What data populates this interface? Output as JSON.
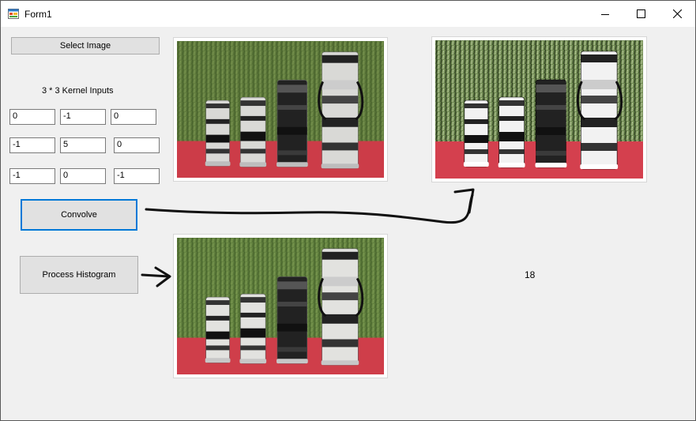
{
  "window": {
    "title": "Form1"
  },
  "buttons": {
    "select_image": "Select Image",
    "convolve": "Convolve",
    "process_histogram": "Process Histogram"
  },
  "kernel": {
    "label": "3 * 3 Kernel Inputs",
    "rows": [
      [
        "0",
        "-1",
        "0"
      ],
      [
        "-1",
        "5",
        "0"
      ],
      [
        "-1",
        "0",
        "-1"
      ]
    ]
  },
  "result_label": "18",
  "images": {
    "original": "lens-photo",
    "convolved": "sharpened-lens-photo",
    "histogram": "histogram-equalized-lens-photo"
  },
  "icons": [
    "app-icon",
    "minimize-icon",
    "maximize-icon",
    "close-icon"
  ]
}
